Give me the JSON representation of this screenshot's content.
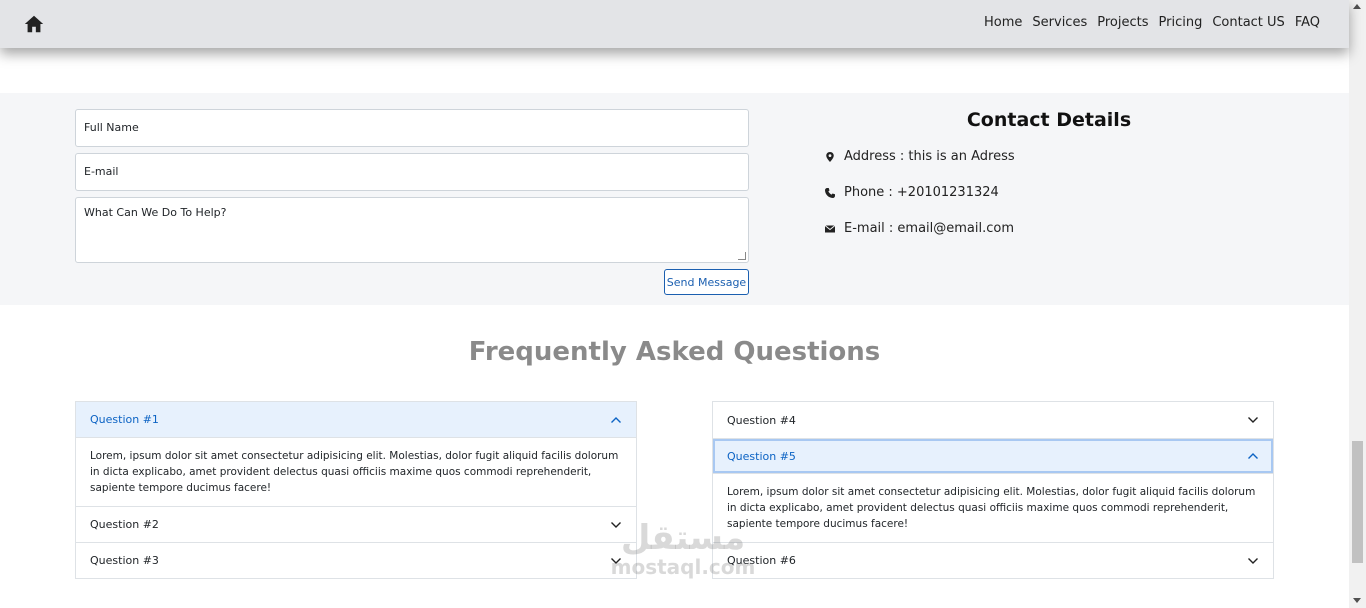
{
  "nav": {
    "home_icon": "home-icon",
    "links": [
      "Home",
      "Services",
      "Projects",
      "Pricing",
      "Contact US",
      "FAQ"
    ]
  },
  "form": {
    "name_placeholder": "Full Name",
    "email_placeholder": "E-mail",
    "message_placeholder": "What Can We Do To Help?",
    "send_label": "Send Message"
  },
  "contact": {
    "title": "Contact Details",
    "address": "Address : this is an Adress",
    "phone": "Phone : +20101231324",
    "email": "E-mail : email@email.com"
  },
  "faq": {
    "title": "Frequently Asked Questions",
    "left": [
      {
        "q": "Question #1",
        "a": "Lorem, ipsum dolor sit amet consectetur adipisicing elit. Molestias, dolor fugit aliquid facilis dolorum in dicta explicabo, amet provident delectus quasi officiis maxime quos commodi reprehenderit, sapiente tempore ducimus facere!"
      },
      {
        "q": "Question #2"
      },
      {
        "q": "Question #3"
      }
    ],
    "right": [
      {
        "q": "Question #4"
      },
      {
        "q": "Question #5",
        "a": "Lorem, ipsum dolor sit amet consectetur adipisicing elit. Molestias, dolor fugit aliquid facilis dolorum in dicta explicabo, amet provident delectus quasi officiis maxime quos commodi reprehenderit, sapiente tempore ducimus facere!"
      },
      {
        "q": "Question #6"
      }
    ]
  },
  "watermark": {
    "arabic": "مستقل",
    "latin": "mostaql.com"
  },
  "colors": {
    "accent": "#0c63c4",
    "open_bg": "#e7f1fd",
    "navbar_bg": "#e3e4e7",
    "section_bg": "#f5f6f8",
    "faq_title": "#8a8a8a"
  }
}
